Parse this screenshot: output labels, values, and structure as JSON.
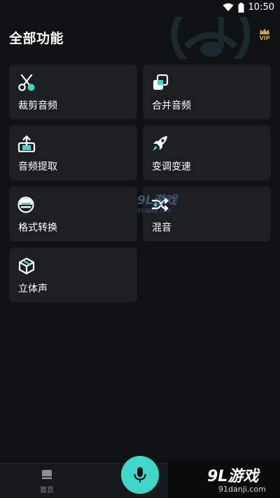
{
  "status_bar": {
    "time": "10:50"
  },
  "header": {
    "title": "全部功能",
    "vip_label": "VIP"
  },
  "features": [
    {
      "label": "裁剪音频",
      "icon": "scissors-icon"
    },
    {
      "label": "合并音频",
      "icon": "merge-icon"
    },
    {
      "label": "音频提取",
      "icon": "extract-icon"
    },
    {
      "label": "变调变速",
      "icon": "rocket-icon"
    },
    {
      "label": "格式转换",
      "icon": "convert-icon"
    },
    {
      "label": "混音",
      "icon": "shuffle-icon"
    },
    {
      "label": "立体声",
      "icon": "cube-icon"
    }
  ],
  "bottom_nav": {
    "home_label": "首页",
    "mic_icon": "microphone-icon"
  },
  "watermark": {
    "brand": "9L游戏",
    "site": "91danji.com"
  },
  "colors": {
    "accent": "#3fd7c7",
    "card": "#1c1f22",
    "background": "#0f1213",
    "vip": "#c9a24a"
  }
}
